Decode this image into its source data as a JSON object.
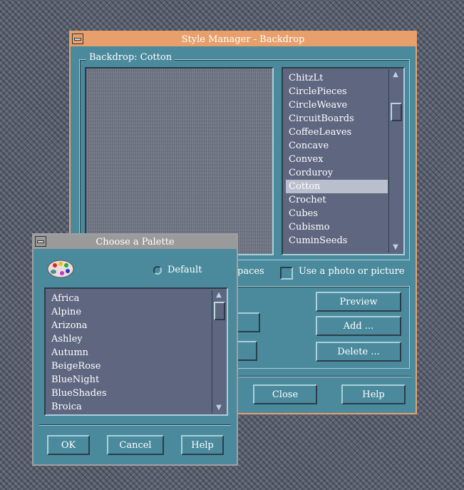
{
  "style_manager": {
    "title": "Style Manager - Backdrop",
    "frame_label": "Backdrop: Cotton",
    "backdrops": [
      "ChitzLt",
      "CirclePieces",
      "CircleWeave",
      "CircuitBoards",
      "CoffeeLeaves",
      "Concave",
      "Convex",
      "Corduroy",
      "Cotton",
      "Crochet",
      "Cubes",
      "Cubismo",
      "CuminSeeds"
    ],
    "selected_backdrop": "Cotton",
    "workspaces_partial": "paces",
    "photo_checkbox_label": "Use a photo or picture",
    "buttons": {
      "preview": "Preview",
      "add": "Add ...",
      "delete": "Delete ...",
      "close": "Close",
      "help": "Help"
    }
  },
  "palette_dialog": {
    "title": "Choose a Palette",
    "default_label": "Default",
    "palettes": [
      "Africa",
      "Alpine",
      "Arizona",
      "Ashley",
      "Autumn",
      "BeigeRose",
      "BlueNight",
      "BlueShades",
      "Broica"
    ],
    "buttons": {
      "ok": "OK",
      "cancel": "Cancel",
      "help": "Help"
    }
  },
  "colors": {
    "window_bg": "#4a8a9c",
    "titlebar_active": "#e7a06c",
    "titlebar_inactive": "#9a9a9a",
    "list_bg": "#5f6680",
    "selection": "#b9bfcc"
  }
}
